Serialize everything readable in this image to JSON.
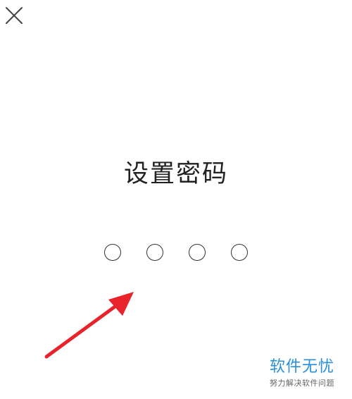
{
  "header": {
    "close_icon": "close-icon"
  },
  "screen": {
    "title": "设置密码",
    "pin_length": 4,
    "pin_filled": 0
  },
  "annotation": {
    "arrow_color": "#e8232b"
  },
  "watermark": {
    "main": "软件无忧",
    "sub": "努力解决软件问题",
    "color": "#2a8fd8"
  }
}
